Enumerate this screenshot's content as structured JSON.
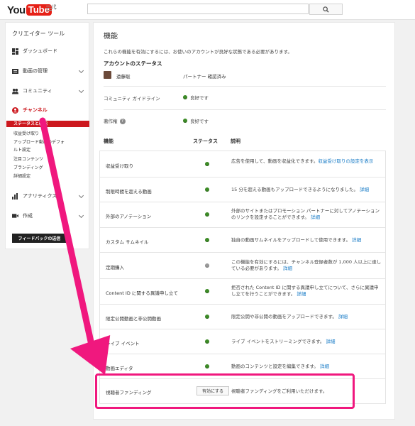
{
  "header": {
    "logo_you": "You",
    "logo_tube": "Tube",
    "logo_region": "JP",
    "search_placeholder": ""
  },
  "sidebar": {
    "title": "クリエイター ツール",
    "items": [
      {
        "label": "ダッシュボード",
        "icon": "dashboard-icon"
      },
      {
        "label": "動画の管理",
        "icon": "video-manager-icon"
      },
      {
        "label": "コミュニティ",
        "icon": "community-icon"
      },
      {
        "label": "チャンネル",
        "icon": "channel-icon"
      },
      {
        "label": "アナリティクス",
        "icon": "analytics-icon"
      },
      {
        "label": "作成",
        "icon": "create-icon"
      }
    ],
    "channel_sub": [
      "ステータスと機能",
      "収益受け取り",
      "アップロード動画のデフォ",
      "ルト設定",
      "注目コンテンツ",
      "ブランディング",
      "詳細設定"
    ],
    "feedback_label": "フィードバックの送信"
  },
  "main": {
    "title": "機能",
    "intro": "これらの機能を有効にするには、お使いのアカウントが良好な状態である必要があります。",
    "account_status_title": "アカウントのステータス",
    "account_name": "遠藤聡",
    "account_status": "パートナー 確認済み",
    "status_rows": [
      {
        "label": "コミュニティ ガイドライン",
        "value": "良好です"
      },
      {
        "label": "著作権",
        "value": "良好です"
      }
    ],
    "headers": {
      "feature": "機能",
      "status": "ステータス",
      "desc": "説明"
    },
    "features": [
      {
        "name": "収益受け取り",
        "status": "green",
        "desc": "広告を使用して、動画を収益化できます。",
        "link": "収益受け取りの設定を表示"
      },
      {
        "name": "制限時間を超える動画",
        "status": "green",
        "desc": "15 分を超える動画もアップロードできるようになりました。",
        "link": "詳細"
      },
      {
        "name": "外部のアノテーション",
        "status": "green",
        "desc": "外部のサイトまたはプロモーション パートナーに対してアノテーションのリンクを設定することができます。",
        "link": "詳細"
      },
      {
        "name": "カスタム サムネイル",
        "status": "green",
        "desc": "独自の動画サムネイルをアップロードして使用できます。",
        "link": "詳細"
      },
      {
        "name": "定期購入",
        "status": "gray",
        "desc": "この機能を有効にするには、チャンネル登録者数が 1,000 人以上に達している必要があります。",
        "link": "詳細"
      },
      {
        "name": "Content ID に関する異議申し立て",
        "status": "green",
        "desc": "拒否された Content ID に関する異議申し立てについて、さらに異議申し立てを行うことができます。",
        "link": "詳細"
      },
      {
        "name": "限定公開動画と非公開動画",
        "status": "green",
        "desc": "限定公開や非公開の動画をアップロードできます。",
        "link": "詳細"
      },
      {
        "name": "ライブ イベント",
        "status": "green",
        "desc": "ライブ イベントをストリーミングできます。",
        "link": "詳細"
      },
      {
        "name": "動画エディタ",
        "status": "green",
        "desc": "動画のコンテンツと設定を編集できます。",
        "link": "詳細"
      },
      {
        "name": "視聴者ファンディング",
        "status": "button",
        "button_label": "有効にする",
        "desc": "視聴者ファンディングをご利用いただけます。",
        "link": ""
      }
    ]
  },
  "colors": {
    "brand_red": "#e62117",
    "sidebar_active": "#cc181e",
    "link_blue": "#167ac6",
    "status_green": "#3d8c27",
    "status_gray": "#9a9a9a",
    "annotation_pink": "#f0187e"
  }
}
